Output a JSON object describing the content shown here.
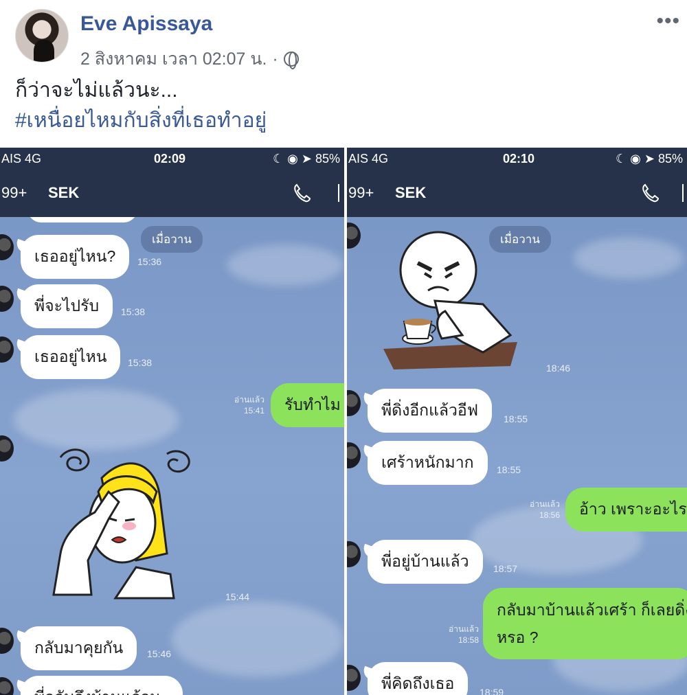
{
  "post": {
    "author": "Eve Apissaya",
    "timestamp": "2 สิงหาคม เวลา 02:07 น.",
    "separator": "·",
    "privacy_icon": "globe-icon",
    "more_icon": "•••",
    "text": "ก็ว่าจะไม่แล้วนะ...",
    "hashtag": "#เหนื่อยไหมกับสิ่งที่เธอทำอยู่"
  },
  "left_screen": {
    "status": {
      "carrier": "AIS  4G",
      "time": "02:09",
      "battery": "85%"
    },
    "nav": {
      "unread": "99+",
      "chat_name": "SEK"
    },
    "date_pill": "เมื่อวาน",
    "messages": [
      {
        "dir": "in",
        "text": "เธออยู่ไหน?",
        "time": "15:36"
      },
      {
        "dir": "in",
        "text": "พี่จะไปรับ",
        "time": "15:38"
      },
      {
        "dir": "in",
        "text": "เธออยู่ไหน",
        "time": "15:38"
      },
      {
        "dir": "out",
        "text": "รับทำไม",
        "read": "อ่านแล้ว",
        "time": "15:41"
      },
      {
        "dir": "sticker",
        "time": "15:44"
      },
      {
        "dir": "in",
        "text": "กลับมาคุยกัน",
        "time": "15:46"
      },
      {
        "dir": "in",
        "text": "พี่กลับถึงบ้านแล้วนะ",
        "time": ""
      }
    ]
  },
  "right_screen": {
    "status": {
      "carrier": "AIS  4G",
      "time": "02:10",
      "battery": "85%"
    },
    "nav": {
      "unread": "99+",
      "chat_name": "SEK"
    },
    "date_pill": "เมื่อวาน",
    "messages": [
      {
        "dir": "sticker",
        "time": "18:46"
      },
      {
        "dir": "in",
        "text": "พี่ดิ่งอีกแล้วอีฟ",
        "time": "18:55"
      },
      {
        "dir": "in",
        "text": "เศร้าหนักมาก",
        "time": "18:55"
      },
      {
        "dir": "out",
        "text": "อ้าว เพราะอะไร",
        "read": "อ่านแล้ว",
        "time": "18:56"
      },
      {
        "dir": "in",
        "text": "พี่อยู่บ้านแล้ว",
        "time": "18:57"
      },
      {
        "dir": "out",
        "text": "กลับมาบ้านแล้วเศร้า ก็เลยดิ่ง",
        "text2": "หรอ ?",
        "read": "อ่านแล้ว",
        "time": "18:58"
      },
      {
        "dir": "in",
        "text": "พี่คิดถึงเธอ",
        "time": "18:59"
      }
    ]
  }
}
